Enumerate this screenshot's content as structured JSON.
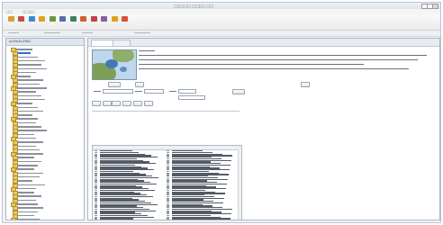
{
  "window": {
    "title": "□□□□□ □□□□ □□"
  },
  "menubar": {
    "items": [
      "□□",
      "□□□□"
    ]
  },
  "toolbar": {
    "buttons": [
      {
        "icon": "folder-icon",
        "color": "#d8a030"
      },
      {
        "icon": "tool-icon",
        "color": "#c05040"
      },
      {
        "icon": "globe-icon",
        "color": "#3a8ad0"
      },
      {
        "icon": "layer-icon",
        "color": "#e0a020"
      },
      {
        "icon": "chart-icon",
        "color": "#6a9a40"
      },
      {
        "icon": "table-icon",
        "color": "#5070b0"
      },
      {
        "icon": "map-icon",
        "color": "#408060"
      },
      {
        "icon": "filter-icon",
        "color": "#d06030"
      },
      {
        "icon": "export-icon",
        "color": "#c04040"
      },
      {
        "icon": "settings-icon",
        "color": "#8060a0"
      },
      {
        "icon": "info-icon",
        "color": "#e0a020"
      },
      {
        "icon": "help-icon",
        "color": "#e05030"
      }
    ]
  },
  "colors": {
    "accent": "#2f6fd6",
    "panel_border": "#a9b6c8",
    "folder": "#e8c860"
  }
}
